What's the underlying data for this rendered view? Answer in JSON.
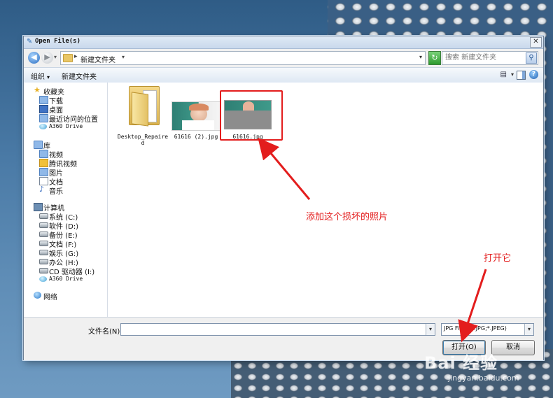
{
  "window": {
    "title": "Open File(s)"
  },
  "navigation": {
    "address_path": "新建文件夹",
    "search_placeholder": "搜索 新建文件夹"
  },
  "commandbar": {
    "organize_label": "组织",
    "newfolder_label": "新建文件夹"
  },
  "sidebar": {
    "favorites": {
      "label": "收藏夹",
      "items": [
        "下载",
        "桌面",
        "最近访问的位置",
        "A360 Drive"
      ]
    },
    "libraries": {
      "label": "库",
      "items": [
        "视频",
        "腾讯视频",
        "图片",
        "文档",
        "音乐"
      ]
    },
    "computer": {
      "label": "计算机",
      "items": [
        "系统 (C:)",
        "软件 (D:)",
        "备份 (E:)",
        "文档 (F:)",
        "娱乐 (G:)",
        "办公 (H:)",
        "CD 驱动器 (I:)",
        "A360 Drive"
      ]
    },
    "network": {
      "label": "网络"
    }
  },
  "files": [
    {
      "name": "Desktop_Repaired",
      "name_line1": "Desktop_Repaire",
      "name_line2": "d",
      "type": "folder"
    },
    {
      "name": "61616 (2).jpg",
      "type": "image"
    },
    {
      "name": "61616.jpg",
      "type": "image",
      "selected": true
    }
  ],
  "footer": {
    "filename_label": "文件名(N):",
    "filename_value": "",
    "filter_value": "JPG Files (*.JPG;*.JPEG)",
    "open_label": "打开(O)",
    "cancel_label": "取消"
  },
  "annotations": {
    "file_note": "添加这个损坏的照片",
    "open_note": "打开它"
  },
  "colors": {
    "annotation": "#e31d1d",
    "accent": "#2b6db7"
  },
  "watermark": {
    "brand": "Bai 经验",
    "sub": "jingyan.baidu.com"
  }
}
